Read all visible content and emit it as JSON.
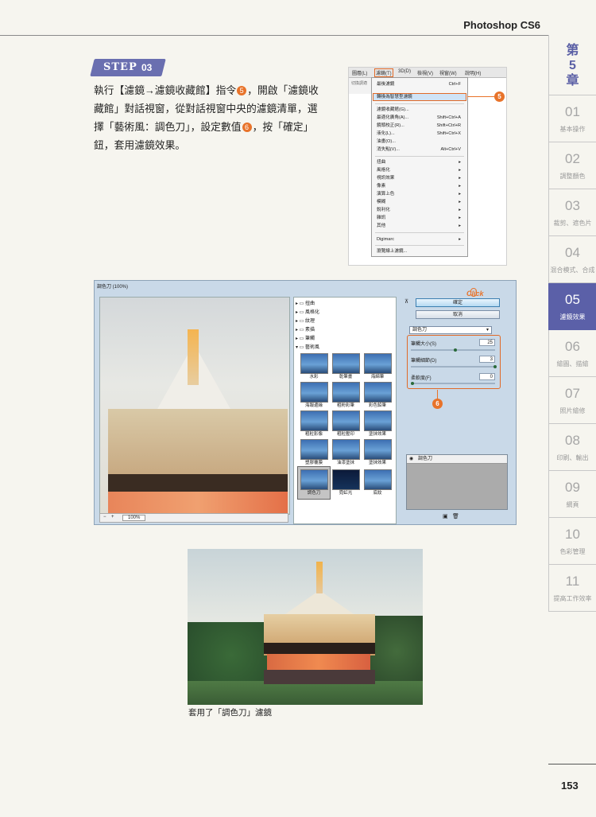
{
  "header": {
    "book_title": "Photoshop CS6"
  },
  "chapter": {
    "prefix": "第",
    "number": "5",
    "suffix": "章"
  },
  "tabs": [
    {
      "num": "01",
      "label": "基本操作"
    },
    {
      "num": "02",
      "label": "調整顏色"
    },
    {
      "num": "03",
      "label": "裁剪、遮色片"
    },
    {
      "num": "04",
      "label": "混合模式、合成"
    },
    {
      "num": "05",
      "label": "濾鏡效果",
      "active": true
    },
    {
      "num": "06",
      "label": "繪圖、描繪"
    },
    {
      "num": "07",
      "label": "照片繪修"
    },
    {
      "num": "08",
      "label": "印刷、輸出"
    },
    {
      "num": "09",
      "label": "網頁"
    },
    {
      "num": "10",
      "label": "色彩管理"
    },
    {
      "num": "11",
      "label": "提高工作效率"
    }
  ],
  "step": {
    "label": "STEP",
    "number": "03"
  },
  "instruction": {
    "line1": "執行【濾鏡→濾鏡收藏館】指令",
    "marker5": "5",
    "line1b": "，開啟「濾鏡收",
    "line2": "藏館」對話視窗，從對話視窗中央的濾鏡清單，選",
    "line3a": "擇「藝術風：調色刀」，設定數值",
    "marker6": "6",
    "line3b": "，按「確定」",
    "line4": "鈕，套用濾鏡效果。"
  },
  "menu": {
    "bar": [
      "圖層(L)",
      "濾鏡(T)",
      "3D(D)",
      "檢視(V)",
      "視窗(W)",
      "說明(H)"
    ],
    "left_label": "切換調適",
    "items_top": [
      {
        "label": "最後濾鏡",
        "shortcut": "Ctrl+F"
      },
      {
        "label": "轉換為智慧型濾鏡",
        "shortcut": ""
      }
    ],
    "highlighted": "轉換為智慧型濾鏡",
    "items_mid": [
      {
        "label": "濾鏡收藏館(G)...",
        "shortcut": ""
      },
      {
        "label": "最適化廣角(A)...",
        "shortcut": "Shift+Ctrl+A"
      },
      {
        "label": "鏡頭校正(R)...",
        "shortcut": "Shift+Ctrl+R"
      },
      {
        "label": "液化(L)...",
        "shortcut": "Shift+Ctrl+X"
      },
      {
        "label": "油畫(O)...",
        "shortcut": ""
      },
      {
        "label": "消失點(V)...",
        "shortcut": "Alt+Ctrl+V"
      }
    ],
    "items_sub": [
      "扭曲",
      "風格化",
      "視訊效果",
      "像素",
      "演算上色",
      "模糊",
      "銳利化",
      "雜訊",
      "其他"
    ],
    "items_bottom": [
      "Digimarc",
      "瀏覽線上濾鏡..."
    ],
    "marker": "5"
  },
  "gallery": {
    "title": "調色刀 (100%)",
    "zoom": "100%",
    "categories": [
      "扭曲",
      "風格化",
      "紋理",
      "素描",
      "筆觸",
      "藝術風"
    ],
    "thumbs": [
      [
        "水彩",
        "乾筆畫",
        "海綿筆"
      ],
      [
        "海報邊緣",
        "粗粉彩筆",
        "彩色鉛筆"
      ],
      [
        "粗粒影像",
        "粗粒壓印",
        "塗抹效果"
      ],
      [
        "塑膠覆膜",
        "油漆塗抹",
        "塗抹效果"
      ],
      [
        "調色刀",
        "霓虹光",
        "底紋"
      ]
    ],
    "ok": "確定",
    "cancel": "取消",
    "click_label": "Click",
    "filter_select": "調色刀",
    "params": [
      {
        "label": "筆觸大小(S)",
        "value": "25"
      },
      {
        "label": "筆觸細節(D)",
        "value": "3"
      },
      {
        "label": "柔軟度(F)",
        "value": "0"
      }
    ],
    "marker": "6",
    "layer": "調色刀"
  },
  "caption": "套用了「調色刀」濾鏡",
  "page_number": "153"
}
